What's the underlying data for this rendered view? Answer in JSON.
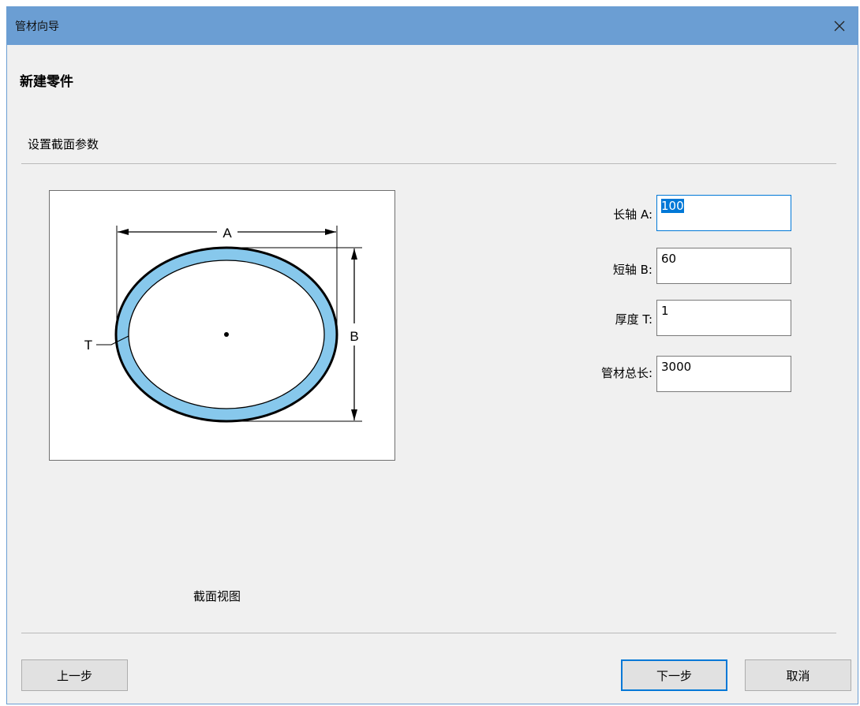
{
  "window": {
    "title": "管材向导"
  },
  "page": {
    "heading": "新建零件",
    "subheading": "设置截面参数"
  },
  "preview": {
    "caption": "截面视图",
    "dim_a": "A",
    "dim_b": "B",
    "dim_t": "T",
    "ring_color": "#87c8ec"
  },
  "fields": {
    "major_axis": {
      "label": "长轴 A:",
      "value": "100"
    },
    "minor_axis": {
      "label": "短轴 B:",
      "value": "60"
    },
    "thickness": {
      "label": "厚度 T:",
      "value": "1"
    },
    "total_length": {
      "label": "管材总长:",
      "value": "3000"
    }
  },
  "buttons": {
    "prev": "上一步",
    "next": "下一步",
    "cancel": "取消"
  },
  "colors": {
    "titlebar": "#6b9ed3",
    "accent": "#0078d7"
  }
}
